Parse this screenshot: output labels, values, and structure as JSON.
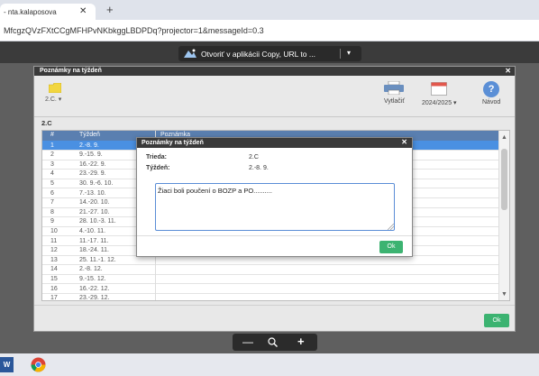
{
  "browser": {
    "tab_title": "- nta.kalaposova",
    "tab_close": "✕",
    "new_tab": "+",
    "url": "MfcgzQVzFXtCCgMFHPvNKbkggLBDPDq?projector=1&messageId=0.3"
  },
  "viewer": {
    "open_in_label": "Otvoriť v aplikácii Copy, URL to ...",
    "open_in_chevron": "▾"
  },
  "outer_modal": {
    "title": "Poznámky na týždeň",
    "close": "✕",
    "class_select": "2.C. ▾",
    "print_label": "Vytlačiť",
    "year_label": "2024/2025 ▾",
    "help_label": "Návod",
    "help_glyph": "?",
    "section_label": "2.C",
    "col_num": "#",
    "col_week": "Týždeň",
    "col_note": "Poznámka",
    "ok_label": "Ok",
    "rows": [
      {
        "num": "1",
        "week": "2.-8. 9."
      },
      {
        "num": "2",
        "week": "9.-15. 9."
      },
      {
        "num": "3",
        "week": "16.-22. 9."
      },
      {
        "num": "4",
        "week": "23.-29. 9."
      },
      {
        "num": "5",
        "week": "30. 9.-6. 10."
      },
      {
        "num": "6",
        "week": "7.-13. 10."
      },
      {
        "num": "7",
        "week": "14.-20. 10."
      },
      {
        "num": "8",
        "week": "21.-27. 10."
      },
      {
        "num": "9",
        "week": "28. 10.-3. 11."
      },
      {
        "num": "10",
        "week": "4.-10. 11."
      },
      {
        "num": "11",
        "week": "11.-17. 11."
      },
      {
        "num": "12",
        "week": "18.-24. 11."
      },
      {
        "num": "13",
        "week": "25. 11.-1. 12."
      },
      {
        "num": "14",
        "week": "2.-8. 12."
      },
      {
        "num": "15",
        "week": "9.-15. 12."
      },
      {
        "num": "16",
        "week": "16.-22. 12."
      },
      {
        "num": "17",
        "week": "23.-29. 12."
      }
    ],
    "selected_row": 0
  },
  "inner_dialog": {
    "title": "Poznámky na týždeň",
    "close": "✕",
    "class_label": "Trieda:",
    "class_value": "2.C",
    "week_label": "Týždeň:",
    "week_value": "2.-8. 9.",
    "note_value": "Žiaci boli poučení o BOZP a PO..........",
    "ok_label": "Ok"
  },
  "zoom": {
    "minus": "—",
    "plus": "+"
  },
  "taskbar": {
    "word_glyph": "W"
  },
  "colors": {
    "accent_green": "#3cb371",
    "selection_blue": "#4a90e2",
    "header_dark": "#3a3a3a"
  }
}
